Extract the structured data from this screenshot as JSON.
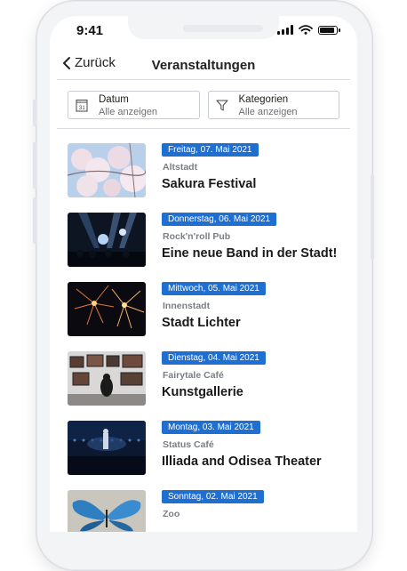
{
  "status": {
    "time": "9:41"
  },
  "nav": {
    "back_label": "Zurück",
    "title": "Veranstaltungen"
  },
  "filters": [
    {
      "title": "Datum",
      "value": "Alle anzeigen",
      "icon": "calendar-icon"
    },
    {
      "title": "Kategorien",
      "value": "Alle anzeigen",
      "icon": "filter-icon"
    }
  ],
  "events": [
    {
      "date": "Freitag, 07. Mai 2021",
      "venue": "Altstadt",
      "title": "Sakura Festival",
      "image": "cherry-blossom-photo"
    },
    {
      "date": "Donnerstag, 06. Mai 2021",
      "venue": "Rock'n'roll Pub",
      "title": "Eine neue Band in der Stadt!",
      "image": "concert-stage-photo"
    },
    {
      "date": "Mittwoch, 05. Mai 2021",
      "venue": "Innenstadt",
      "title": "Stadt Lichter",
      "image": "fireworks-photo"
    },
    {
      "date": "Dienstag, 04. Mai 2021",
      "venue": "Fairytale Café",
      "title": "Kunstgallerie",
      "image": "art-gallery-photo"
    },
    {
      "date": "Montag, 03. Mai 2021",
      "venue": "Status Café",
      "title": "Illiada and Odisea Theater",
      "image": "theater-stage-photo"
    },
    {
      "date": "Sonntag, 02. Mai 2021",
      "venue": "Zoo",
      "title": "",
      "image": "butterfly-photo"
    }
  ],
  "colors": {
    "accent": "#1f6fd1",
    "frame": "#f3f4f6",
    "divider": "#d9dbe0"
  }
}
